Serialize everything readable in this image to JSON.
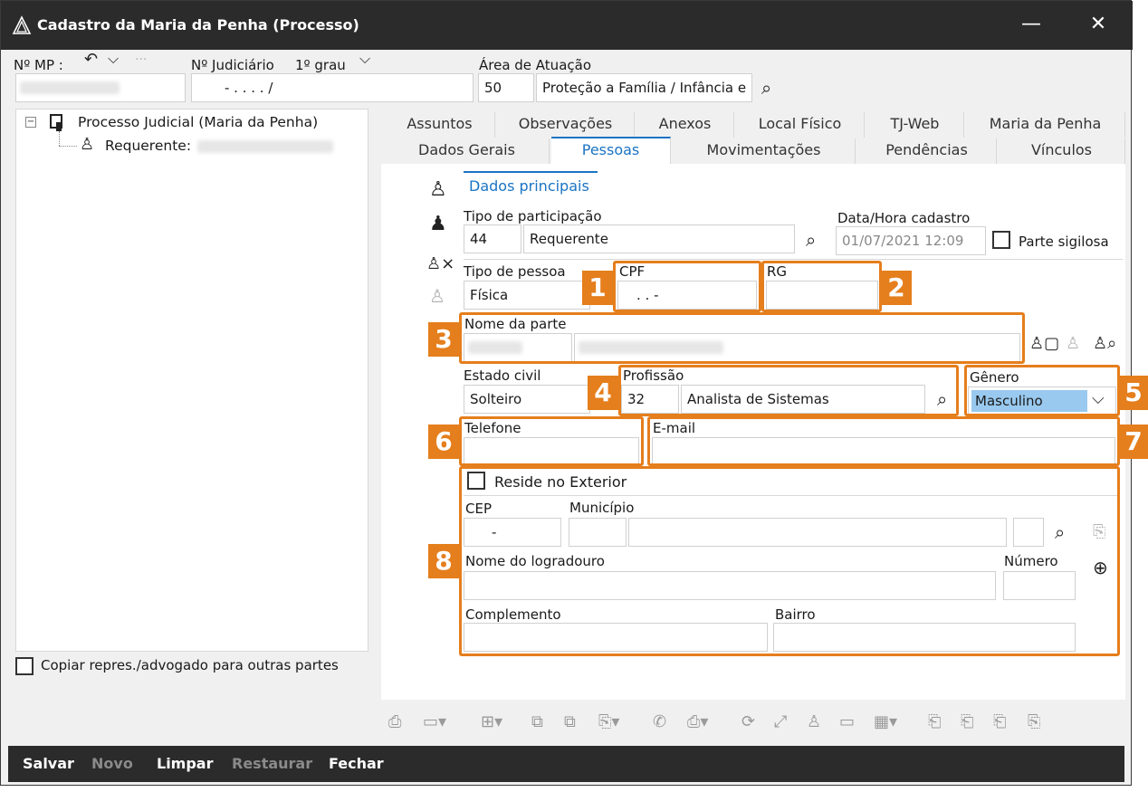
{
  "window": {
    "title": "Cadastro da Maria da Penha (Processo)",
    "minimize": "—",
    "close": "✕"
  },
  "header": {
    "mp_label": "Nº MP :",
    "judiciario_label": "Nº Judiciário",
    "grau": "1º grau",
    "judiciario_value": "- .   . . .   /",
    "area_label": "Área de Atuação",
    "area_code": "50",
    "area_name": "Proteção a Família / Infância e"
  },
  "tree": {
    "root": "Processo Judicial (Maria da Penha)",
    "child": "Requerente:"
  },
  "copy_label": "Copiar repres./advogado para outras partes",
  "tabs_row1": [
    "Assuntos",
    "Observações",
    "Anexos",
    "Local Físico",
    "TJ-Web",
    "Maria da Penha"
  ],
  "tabs_row2": [
    "Dados Gerais",
    "Pessoas",
    "Movimentações",
    "Pendências",
    "Vínculos"
  ],
  "subtab": "Dados principais",
  "form": {
    "tipo_participacao_label": "Tipo de participação",
    "tipo_participacao_code": "44",
    "tipo_participacao_name": "Requerente",
    "data_label": "Data/Hora cadastro",
    "data_value": "01/07/2021 12:09",
    "parte_sigilosa": "Parte sigilosa",
    "tipo_pessoa_label": "Tipo de pessoa",
    "tipo_pessoa_value": "Física",
    "cpf_label": "CPF",
    "cpf_value": ". .  -",
    "rg_label": "RG",
    "nome_label": "Nome da parte",
    "estado_civil_label": "Estado civil",
    "estado_civil_value": "Solteiro",
    "profissao_label": "Profissão",
    "profissao_code": "32",
    "profissao_name": "Analista de Sistemas",
    "genero_label": "Gênero",
    "genero_value": "Masculino",
    "telefone_label": "Telefone",
    "email_label": "E-mail",
    "reside_exterior": "Reside no Exterior",
    "cep_label": "CEP",
    "cep_value": "-",
    "municipio_label": "Município",
    "logradouro_label": "Nome do logradouro",
    "numero_label": "Número",
    "complemento_label": "Complemento",
    "bairro_label": "Bairro"
  },
  "callouts": [
    "1",
    "2",
    "3",
    "4",
    "5",
    "6",
    "7",
    "8"
  ],
  "footer": {
    "salvar": "Salvar",
    "novo": "Novo",
    "limpar": "Limpar",
    "restaurar": "Restaurar",
    "fechar": "Fechar"
  },
  "colors": {
    "accent": "#1a73c4",
    "callout": "#e57e1c",
    "titlebar": "#2b2b2b"
  }
}
